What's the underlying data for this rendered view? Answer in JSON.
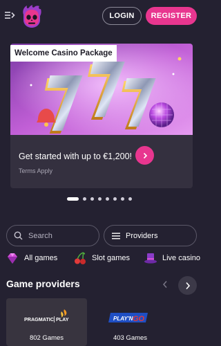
{
  "header": {
    "menu_icon": "menu-collapse-icon",
    "logo_icon": "flaming-skull-logo",
    "login_label": "LOGIN",
    "register_label": "REGISTER"
  },
  "promo": {
    "badge": "Welcome Casino Package",
    "headline": "Get started with up to €1,200!",
    "terms": "Terms Apply",
    "arrow_icon": "chevron-right-icon"
  },
  "carousel": {
    "dot_count": 8,
    "active_index": 0
  },
  "search": {
    "placeholder": "Search",
    "icon": "search-icon"
  },
  "providers_button": {
    "label": "Providers",
    "icon": "list-icon"
  },
  "categories": [
    {
      "label": "All games",
      "icon": "gem-icon"
    },
    {
      "label": "Slot games",
      "icon": "cherries-icon"
    },
    {
      "label": "Live casino",
      "icon": "top-hat-icon"
    }
  ],
  "game_providers": {
    "title": "Game providers",
    "items": [
      {
        "name": "PRAGMATIC PLAY",
        "count": "802 Games"
      },
      {
        "name": "PLAY'N GO",
        "count": "403 Games"
      }
    ]
  },
  "colors": {
    "background": "#242131",
    "accent_pink": "#e8368f",
    "card": "#34303f"
  }
}
